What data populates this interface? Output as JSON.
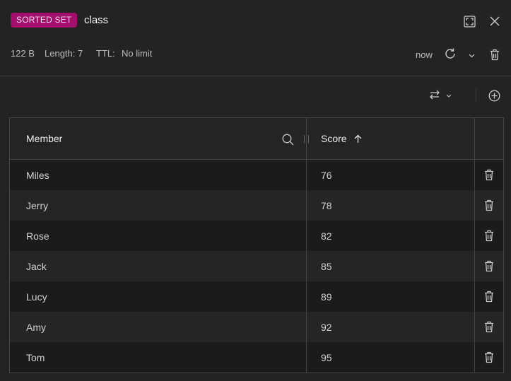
{
  "header": {
    "type_badge": "SORTED SET",
    "key_name": "class",
    "size": "122 B",
    "length": "Length: 7",
    "ttl_label": "TTL:",
    "ttl_value": "No limit",
    "refresh_time": "now"
  },
  "table": {
    "columns": [
      "Member",
      "Score"
    ],
    "rows": [
      {
        "member": "Miles",
        "score": "76"
      },
      {
        "member": "Jerry",
        "score": "78"
      },
      {
        "member": "Rose",
        "score": "82"
      },
      {
        "member": "Jack",
        "score": "85"
      },
      {
        "member": "Lucy",
        "score": "89"
      },
      {
        "member": "Amy",
        "score": "92"
      },
      {
        "member": "Tom",
        "score": "95"
      }
    ]
  },
  "colors": {
    "badge": "#a30f6c",
    "background": "#232323"
  },
  "icons": [
    "fullscreen-icon",
    "close-icon",
    "refresh-icon",
    "chevron-down-icon",
    "trash-icon",
    "swap-icon",
    "plus-circle-icon",
    "search-icon",
    "arrow-up-icon"
  ]
}
